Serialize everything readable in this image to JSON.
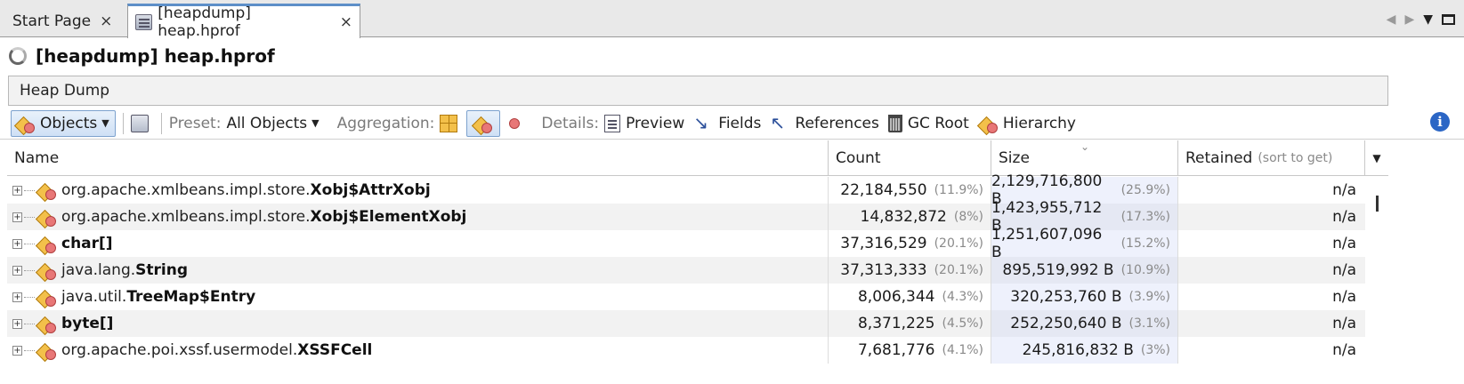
{
  "tabs": [
    {
      "label": "Start Page",
      "active": false
    },
    {
      "label": "[heapdump] heap.hprof",
      "active": true
    }
  ],
  "tab_close_glyph": "×",
  "title": "[heapdump] heap.hprof",
  "panel_label": "Heap Dump",
  "toolbar": {
    "objects_label": "Objects",
    "preset_label": "Preset:",
    "preset_value": "All Objects",
    "aggregation_label": "Aggregation:",
    "details_label": "Details:",
    "preview": "Preview",
    "fields": "Fields",
    "references": "References",
    "gc_root": "GC Root",
    "hierarchy": "Hierarchy",
    "info_glyph": "i"
  },
  "columns": {
    "name": "Name",
    "count": "Count",
    "size": "Size",
    "retained": "Retained",
    "retained_hint": "(sort to get)",
    "sort_glyph": "⌄"
  },
  "rows": [
    {
      "pkg": "org.apache.xmlbeans.impl.store.",
      "cls": "Xobj$AttrXobj",
      "count": "22,184,550",
      "count_pct": "(11.9%)",
      "size": "2,129,716,800 B",
      "size_pct": "(25.9%)",
      "retained": "n/a"
    },
    {
      "pkg": "org.apache.xmlbeans.impl.store.",
      "cls": "Xobj$ElementXobj",
      "count": "14,832,872",
      "count_pct": "(8%)",
      "size": "1,423,955,712 B",
      "size_pct": "(17.3%)",
      "retained": "n/a"
    },
    {
      "pkg": "",
      "cls": "char[]",
      "count": "37,316,529",
      "count_pct": "(20.1%)",
      "size": "1,251,607,096 B",
      "size_pct": "(15.2%)",
      "retained": "n/a"
    },
    {
      "pkg": "java.lang.",
      "cls": "String",
      "count": "37,313,333",
      "count_pct": "(20.1%)",
      "size": "895,519,992 B",
      "size_pct": "(10.9%)",
      "retained": "n/a"
    },
    {
      "pkg": "java.util.",
      "cls": "TreeMap$Entry",
      "count": "8,006,344",
      "count_pct": "(4.3%)",
      "size": "320,253,760 B",
      "size_pct": "(3.9%)",
      "retained": "n/a"
    },
    {
      "pkg": "",
      "cls": "byte[]",
      "count": "8,371,225",
      "count_pct": "(4.5%)",
      "size": "252,250,640 B",
      "size_pct": "(3.1%)",
      "retained": "n/a"
    },
    {
      "pkg": "org.apache.poi.xssf.usermodel.",
      "cls": "XSSFCell",
      "count": "7,681,776",
      "count_pct": "(4.1%)",
      "size": "245,816,832 B",
      "size_pct": "(3%)",
      "retained": "n/a"
    }
  ],
  "colors": {
    "accent": "#5d8fc8",
    "info": "#2b66c5"
  }
}
